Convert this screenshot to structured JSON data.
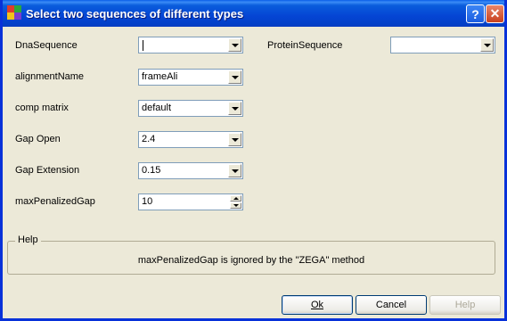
{
  "window": {
    "title": "Select two sequences of different types"
  },
  "titlebar_buttons": {
    "help": "?",
    "close": "✕"
  },
  "fields": {
    "dna": {
      "label": "DnaSequence",
      "value": ""
    },
    "protein": {
      "label": "ProteinSequence",
      "value": ""
    },
    "alignment": {
      "label": "alignmentName",
      "value": "frameAli"
    },
    "matrix": {
      "label": "comp matrix",
      "value": "default"
    },
    "gap_open": {
      "label": "Gap Open",
      "value": "2.4"
    },
    "gap_ext": {
      "label": "Gap Extension",
      "value": "0.15"
    },
    "max_gap": {
      "label": "maxPenalizedGap",
      "value": "10"
    }
  },
  "help": {
    "legend": "Help",
    "message": "maxPenalizedGap is ignored by the \"ZEGA\" method"
  },
  "buttons": {
    "ok": "Ok",
    "cancel": "Cancel",
    "help": "Help"
  }
}
